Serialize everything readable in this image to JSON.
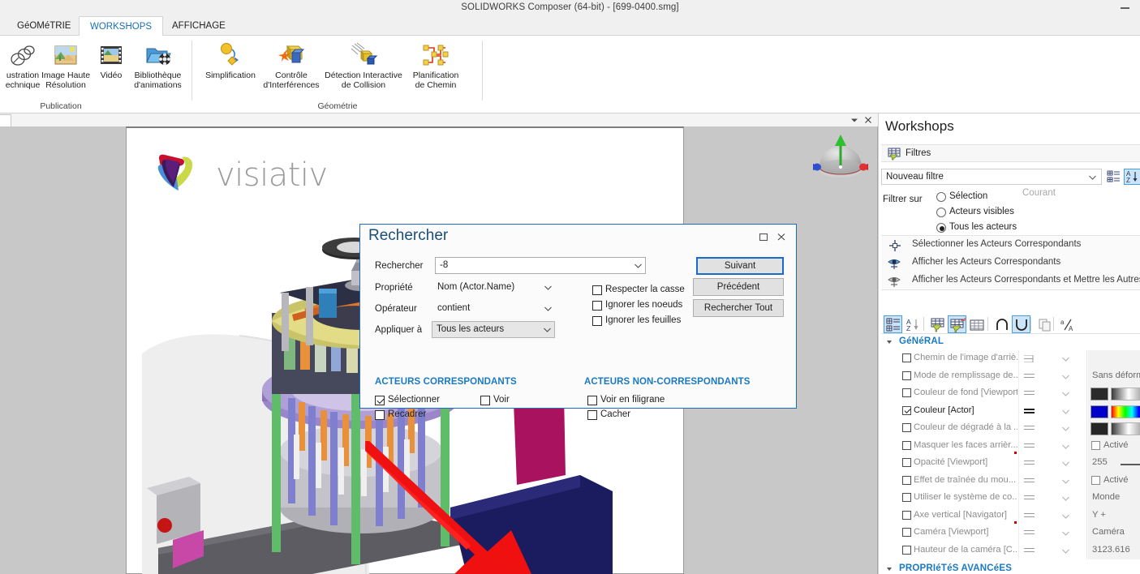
{
  "window": {
    "title": "SOLIDWORKS Composer (64-bit) - [699-0400.smg]",
    "minimize_label": "minimize"
  },
  "ribbon": {
    "tabs": [
      {
        "label": "GéOMéTRIE",
        "active": false
      },
      {
        "label": "WORKSHOPS",
        "active": true
      },
      {
        "label": "AFFICHAGE",
        "active": false
      }
    ],
    "groups": [
      {
        "label": "Publication",
        "items": [
          {
            "label": "ustration\nechnique",
            "icon": "technical-illustration-icon"
          },
          {
            "label": "Image Haute\nRésolution",
            "icon": "high-res-image-icon"
          },
          {
            "label": "Vidéo",
            "icon": "video-icon"
          },
          {
            "label": "Bibliothèque\nd'animations",
            "icon": "animation-library-icon"
          }
        ]
      },
      {
        "label": "Géométrie",
        "items": [
          {
            "label": "Simplification",
            "icon": "simplification-icon"
          },
          {
            "label": "Contrôle\nd'Interférences",
            "icon": "interference-check-icon"
          },
          {
            "label": "Détection Interactive\nde Collision",
            "icon": "collision-detection-icon"
          },
          {
            "label": "Planification\nde Chemin",
            "icon": "path-planning-icon"
          }
        ]
      }
    ]
  },
  "viewport": {
    "logo_text": "visiativ",
    "collapse_icon": "chevron-down-icon",
    "close_icon": "close-icon",
    "nav_compass_icon": "navigation-compass-icon"
  },
  "dialog": {
    "title": "Rechercher",
    "maximize_icon": "maximize-icon",
    "close_icon": "close-icon",
    "fields": {
      "search_label": "Rechercher",
      "search_value": "-8",
      "property_label": "Propriété",
      "property_value": "Nom (Actor.Name)",
      "operator_label": "Opérateur",
      "operator_value": "contient",
      "applyto_label": "Appliquer à",
      "applyto_value": "Tous les acteurs"
    },
    "options": [
      {
        "label": "Respecter la casse",
        "checked": false
      },
      {
        "label": "Ignorer les noeuds",
        "checked": false
      },
      {
        "label": "Ignorer les feuilles",
        "checked": false
      }
    ],
    "buttons": [
      {
        "label": "Suivant",
        "primary": true
      },
      {
        "label": "Précédent",
        "primary": false
      },
      {
        "label": "Rechercher Tout",
        "primary": false
      }
    ],
    "matching": {
      "heading": "ACTEURS CORRESPONDANTS",
      "options": [
        {
          "label": "Sélectionner",
          "checked": true
        },
        {
          "label": "Voir",
          "checked": false
        },
        {
          "label": "Recadrer",
          "checked": false
        }
      ]
    },
    "non_matching": {
      "heading": "ACTEURS NON-CORRESPONDANTS",
      "options": [
        {
          "label": "Voir en filigrane",
          "checked": false
        },
        {
          "label": "Cacher",
          "checked": false
        }
      ]
    }
  },
  "right_panel": {
    "title": "Workshops",
    "section": {
      "label": "Filtres",
      "icon": "filter-table-icon"
    },
    "filter_select": {
      "value": "Nouveau filtre",
      "arrow_icon": "chevron-down-icon"
    },
    "filter_buttons": [
      {
        "icon": "group-list-icon",
        "selected": false
      },
      {
        "icon": "sort-az-icon",
        "selected": true
      }
    ],
    "filter_on": {
      "label": "Filtrer sur",
      "options": [
        {
          "label": "Sélection",
          "checked": false
        },
        {
          "label": "Acteurs visibles",
          "checked": false
        },
        {
          "label": "Tous les acteurs",
          "checked": true
        }
      ],
      "current_value": "Courant"
    },
    "actions": [
      {
        "label": "Sélectionner les Acteurs Correspondants",
        "icon": "select-actors-icon"
      },
      {
        "label": "Afficher les Acteurs Correspondants",
        "icon": "show-actors-icon"
      },
      {
        "label": "Afficher les Acteurs Correspondants et Mettre les Autres en",
        "icon": "show-actors-others-icon"
      }
    ],
    "prop_toolbar": [
      {
        "icon": "group-list-icon",
        "selected": true
      },
      {
        "icon": "sort-az-icon",
        "selected": false
      },
      {
        "icon": "filter-table-icon",
        "selected": false
      },
      {
        "icon": "filter-table-new-icon",
        "selected": true
      },
      {
        "icon": "grid-table-icon",
        "selected": false
      },
      {
        "icon": "intersect-icon",
        "selected": false
      },
      {
        "icon": "union-icon",
        "selected": true
      },
      {
        "icon": "copy-icon",
        "selected": false
      },
      {
        "icon": "case-ratio-icon",
        "selected": false
      }
    ],
    "groups": [
      {
        "label": "GéNéRAL"
      },
      {
        "label": "PROPRIéTéS AVANCéES"
      }
    ],
    "properties": [
      {
        "name": "Chemin de l'image d'arriè...",
        "checked": false,
        "op": "exists",
        "value": "",
        "value_type": "empty",
        "active": false
      },
      {
        "name": "Mode de remplissage de...",
        "checked": false,
        "op": "equals",
        "value": "Sans déformati",
        "value_type": "text",
        "active": false
      },
      {
        "name": "Couleur de fond [Viewport]",
        "checked": false,
        "op": "equals",
        "value": "",
        "value_type": "color",
        "swatch": "#2b2b2b",
        "active": false
      },
      {
        "name": "Couleur [Actor]",
        "checked": true,
        "op": "equals",
        "value": "",
        "value_type": "color-rainbow",
        "swatch": "#0000c8",
        "active": true
      },
      {
        "name": "Couleur de dégradé à la ...",
        "checked": false,
        "op": "equals",
        "value": "",
        "value_type": "color",
        "swatch": "#262626",
        "active": false
      },
      {
        "name": "Masquer les faces arrièr...",
        "checked": false,
        "op": "equals",
        "value": "Activé",
        "value_type": "checkbox",
        "active": false,
        "marker": true
      },
      {
        "name": "Opacité [Viewport]",
        "checked": false,
        "op": "equals",
        "value": "255",
        "value_type": "slider",
        "active": false
      },
      {
        "name": "Effet de traînée du mou...",
        "checked": false,
        "op": "equals",
        "value": "Activé",
        "value_type": "checkbox",
        "active": false
      },
      {
        "name": "Utiliser le système de co...",
        "checked": false,
        "op": "equals",
        "value": "Monde",
        "value_type": "text",
        "active": false
      },
      {
        "name": "Axe vertical [Navigator]",
        "checked": false,
        "op": "equals",
        "value": "Y +",
        "value_type": "text",
        "active": false,
        "marker": true
      },
      {
        "name": "Caméra [Viewport]",
        "checked": false,
        "op": "equals",
        "value": "Caméra",
        "value_type": "text",
        "active": false
      },
      {
        "name": "Hauteur de la caméra [C...",
        "checked": false,
        "op": "equals",
        "value": "3123.616",
        "value_type": "text",
        "active": false
      }
    ]
  },
  "colors": {
    "accent_blue": "#1a7ac0",
    "tab_active_text": "#1a6fb5",
    "dialog_border": "#1b6ac9",
    "selection_highlight": "#cce4f7"
  }
}
